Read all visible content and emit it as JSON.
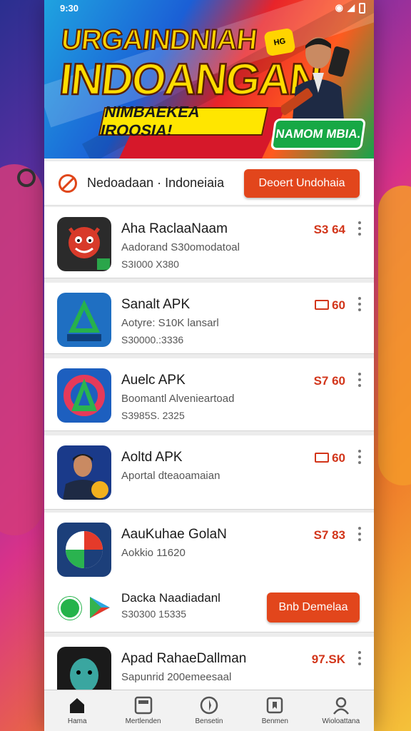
{
  "status_bar": {
    "time": "9:30"
  },
  "banner": {
    "line1": "URGAINDNIAH",
    "line2": "INDOANGAN",
    "line3": "NIMBAEKEA IROOSIA!",
    "badge": "NAMOM MBIA.",
    "box_label": "HG"
  },
  "region": {
    "text": "Nedoadaan · Indoneiaia",
    "button": "Deoert Undohaia"
  },
  "apps": [
    {
      "name": "Aha RaclaaNaam",
      "line2": "Aadorand S30omodatoal",
      "line3": "S3I000 X380",
      "price": "S3 64",
      "price_icon": false
    },
    {
      "name": "Sanalt APK",
      "line2": "Aotyre: S10K lansarl",
      "line3": "S30000.:3336",
      "price": "60",
      "price_icon": true
    },
    {
      "name": "Auelc APK",
      "line2": "Boomantl Alvenieartoad",
      "line3": "S3985S. 2325",
      "price": "S7 60",
      "price_icon": false
    },
    {
      "name": "Aoltd APK",
      "line2": "Aportal dteaoamaian",
      "line3": "",
      "price": "60",
      "price_icon": true
    },
    {
      "name": "AauKuhae GolaN",
      "line2": "Aokkio 11620",
      "line3": "",
      "price": "S7 83",
      "price_icon": false
    },
    {
      "name": "Apad RahaeDallman",
      "line2": "Sapunrid 200emeesaal",
      "line3": "",
      "price": "97.SK",
      "price_icon": false
    }
  ],
  "download_row": {
    "title": "Dacka Naadiadanl",
    "subtitle": "S30300 15335",
    "button": "Bnb Demelaa"
  },
  "nav": [
    {
      "label": "Hama",
      "icon": "home-icon"
    },
    {
      "label": "Mertlenden",
      "icon": "apps-grid-icon"
    },
    {
      "label": "Bensetin",
      "icon": "compass-icon"
    },
    {
      "label": "Benmen",
      "icon": "bookmark-icon"
    },
    {
      "label": "Wioloattana",
      "icon": "profile-icon"
    }
  ],
  "colors": {
    "accent": "#e2461c",
    "price": "#d2351a",
    "badge_green": "#17a845",
    "banner_yellow": "#ffd400"
  }
}
